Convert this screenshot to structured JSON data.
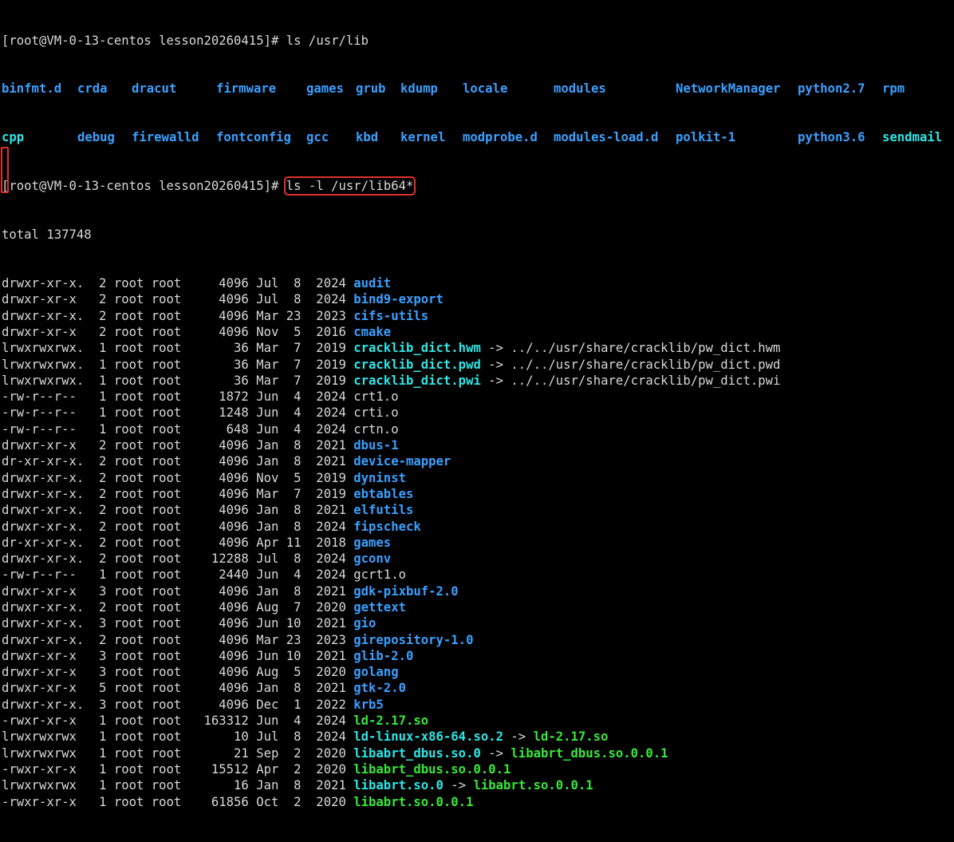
{
  "terminal": {
    "colors": {
      "background": "#000000",
      "text": "#d8d8d8",
      "directory": "#3ba0ff",
      "symlink": "#2ee6e6",
      "executable": "#38e838",
      "highlight": "#e0322b"
    },
    "line1": {
      "prompt": "[root@VM-0-13-centos lesson20260415]# ",
      "command": "ls /usr/lib"
    },
    "lib_row1": [
      {
        "name": "binfmt.d",
        "kind": "dir"
      },
      {
        "name": "crda",
        "kind": "dir"
      },
      {
        "name": "dracut",
        "kind": "dir"
      },
      {
        "name": "firmware",
        "kind": "dir"
      },
      {
        "name": "games",
        "kind": "dir"
      },
      {
        "name": "grub",
        "kind": "dir"
      },
      {
        "name": "kdump",
        "kind": "dir"
      },
      {
        "name": "locale",
        "kind": "dir"
      },
      {
        "name": "modules",
        "kind": "dir"
      },
      {
        "name": "NetworkManager",
        "kind": "dir"
      },
      {
        "name": "python2.7",
        "kind": "dir"
      },
      {
        "name": "rpm",
        "kind": "dir"
      }
    ],
    "lib_row2": [
      {
        "name": "cpp",
        "kind": "link"
      },
      {
        "name": "debug",
        "kind": "dir"
      },
      {
        "name": "firewalld",
        "kind": "dir"
      },
      {
        "name": "fontconfig",
        "kind": "dir"
      },
      {
        "name": "gcc",
        "kind": "dir"
      },
      {
        "name": "kbd",
        "kind": "dir"
      },
      {
        "name": "kernel",
        "kind": "dir"
      },
      {
        "name": "modprobe.d",
        "kind": "dir"
      },
      {
        "name": "modules-load.d",
        "kind": "dir"
      },
      {
        "name": "polkit-1",
        "kind": "dir"
      },
      {
        "name": "python3.6",
        "kind": "dir"
      },
      {
        "name": "sendmail",
        "kind": "link"
      }
    ],
    "line4": {
      "prompt": "[root@VM-0-13-centos lesson20260415]# ",
      "command": "ls -l /usr/lib64*"
    },
    "total": "total 137748",
    "entries": [
      {
        "perm": "drwxr-xr-x.",
        "links": "2",
        "owner": "root",
        "group": "root",
        "size": "4096",
        "month": "Jul",
        "day": "8",
        "year": "2024",
        "name": "audit",
        "kind": "dir",
        "target": "",
        "target_kind": ""
      },
      {
        "perm": "drwxr-xr-x",
        "links": "2",
        "owner": "root",
        "group": "root",
        "size": "4096",
        "month": "Jul",
        "day": "8",
        "year": "2024",
        "name": "bind9-export",
        "kind": "dir",
        "target": "",
        "target_kind": ""
      },
      {
        "perm": "drwxr-xr-x.",
        "links": "2",
        "owner": "root",
        "group": "root",
        "size": "4096",
        "month": "Mar",
        "day": "23",
        "year": "2023",
        "name": "cifs-utils",
        "kind": "dir",
        "target": "",
        "target_kind": ""
      },
      {
        "perm": "drwxr-xr-x",
        "links": "2",
        "owner": "root",
        "group": "root",
        "size": "4096",
        "month": "Nov",
        "day": "5",
        "year": "2016",
        "name": "cmake",
        "kind": "dir",
        "target": "",
        "target_kind": ""
      },
      {
        "perm": "lrwxrwxrwx.",
        "links": "1",
        "owner": "root",
        "group": "root",
        "size": "36",
        "month": "Mar",
        "day": "7",
        "year": "2019",
        "name": "cracklib_dict.hwm",
        "kind": "link",
        "target": "../../usr/share/cracklib/pw_dict.hwm",
        "target_kind": "plain"
      },
      {
        "perm": "lrwxrwxrwx.",
        "links": "1",
        "owner": "root",
        "group": "root",
        "size": "36",
        "month": "Mar",
        "day": "7",
        "year": "2019",
        "name": "cracklib_dict.pwd",
        "kind": "link",
        "target": "../../usr/share/cracklib/pw_dict.pwd",
        "target_kind": "plain"
      },
      {
        "perm": "lrwxrwxrwx.",
        "links": "1",
        "owner": "root",
        "group": "root",
        "size": "36",
        "month": "Mar",
        "day": "7",
        "year": "2019",
        "name": "cracklib_dict.pwi",
        "kind": "link",
        "target": "../../usr/share/cracklib/pw_dict.pwi",
        "target_kind": "plain"
      },
      {
        "perm": "-rw-r--r--",
        "links": "1",
        "owner": "root",
        "group": "root",
        "size": "1872",
        "month": "Jun",
        "day": "4",
        "year": "2024",
        "name": "crt1.o",
        "kind": "file",
        "target": "",
        "target_kind": ""
      },
      {
        "perm": "-rw-r--r--",
        "links": "1",
        "owner": "root",
        "group": "root",
        "size": "1248",
        "month": "Jun",
        "day": "4",
        "year": "2024",
        "name": "crti.o",
        "kind": "file",
        "target": "",
        "target_kind": ""
      },
      {
        "perm": "-rw-r--r--",
        "links": "1",
        "owner": "root",
        "group": "root",
        "size": "648",
        "month": "Jun",
        "day": "4",
        "year": "2024",
        "name": "crtn.o",
        "kind": "file",
        "target": "",
        "target_kind": ""
      },
      {
        "perm": "drwxr-xr-x",
        "links": "2",
        "owner": "root",
        "group": "root",
        "size": "4096",
        "month": "Jan",
        "day": "8",
        "year": "2021",
        "name": "dbus-1",
        "kind": "dir",
        "target": "",
        "target_kind": ""
      },
      {
        "perm": "dr-xr-xr-x.",
        "links": "2",
        "owner": "root",
        "group": "root",
        "size": "4096",
        "month": "Jan",
        "day": "8",
        "year": "2021",
        "name": "device-mapper",
        "kind": "dir",
        "target": "",
        "target_kind": ""
      },
      {
        "perm": "drwxr-xr-x.",
        "links": "2",
        "owner": "root",
        "group": "root",
        "size": "4096",
        "month": "Nov",
        "day": "5",
        "year": "2019",
        "name": "dyninst",
        "kind": "dir",
        "target": "",
        "target_kind": ""
      },
      {
        "perm": "drwxr-xr-x.",
        "links": "2",
        "owner": "root",
        "group": "root",
        "size": "4096",
        "month": "Mar",
        "day": "7",
        "year": "2019",
        "name": "ebtables",
        "kind": "dir",
        "target": "",
        "target_kind": ""
      },
      {
        "perm": "drwxr-xr-x.",
        "links": "2",
        "owner": "root",
        "group": "root",
        "size": "4096",
        "month": "Jan",
        "day": "8",
        "year": "2021",
        "name": "elfutils",
        "kind": "dir",
        "target": "",
        "target_kind": ""
      },
      {
        "perm": "drwxr-xr-x.",
        "links": "2",
        "owner": "root",
        "group": "root",
        "size": "4096",
        "month": "Jan",
        "day": "8",
        "year": "2024",
        "name": "fipscheck",
        "kind": "dir",
        "target": "",
        "target_kind": ""
      },
      {
        "perm": "dr-xr-xr-x.",
        "links": "2",
        "owner": "root",
        "group": "root",
        "size": "4096",
        "month": "Apr",
        "day": "11",
        "year": "2018",
        "name": "games",
        "kind": "dir",
        "target": "",
        "target_kind": ""
      },
      {
        "perm": "drwxr-xr-x.",
        "links": "2",
        "owner": "root",
        "group": "root",
        "size": "12288",
        "month": "Jul",
        "day": "8",
        "year": "2024",
        "name": "gconv",
        "kind": "dir",
        "target": "",
        "target_kind": ""
      },
      {
        "perm": "-rw-r--r--",
        "links": "1",
        "owner": "root",
        "group": "root",
        "size": "2440",
        "month": "Jun",
        "day": "4",
        "year": "2024",
        "name": "gcrt1.o",
        "kind": "file",
        "target": "",
        "target_kind": ""
      },
      {
        "perm": "drwxr-xr-x",
        "links": "3",
        "owner": "root",
        "group": "root",
        "size": "4096",
        "month": "Jan",
        "day": "8",
        "year": "2021",
        "name": "gdk-pixbuf-2.0",
        "kind": "dir",
        "target": "",
        "target_kind": ""
      },
      {
        "perm": "drwxr-xr-x.",
        "links": "2",
        "owner": "root",
        "group": "root",
        "size": "4096",
        "month": "Aug",
        "day": "7",
        "year": "2020",
        "name": "gettext",
        "kind": "dir",
        "target": "",
        "target_kind": ""
      },
      {
        "perm": "drwxr-xr-x.",
        "links": "3",
        "owner": "root",
        "group": "root",
        "size": "4096",
        "month": "Jun",
        "day": "10",
        "year": "2021",
        "name": "gio",
        "kind": "dir",
        "target": "",
        "target_kind": ""
      },
      {
        "perm": "drwxr-xr-x.",
        "links": "2",
        "owner": "root",
        "group": "root",
        "size": "4096",
        "month": "Mar",
        "day": "23",
        "year": "2023",
        "name": "girepository-1.0",
        "kind": "dir",
        "target": "",
        "target_kind": ""
      },
      {
        "perm": "drwxr-xr-x",
        "links": "3",
        "owner": "root",
        "group": "root",
        "size": "4096",
        "month": "Jun",
        "day": "10",
        "year": "2021",
        "name": "glib-2.0",
        "kind": "dir",
        "target": "",
        "target_kind": ""
      },
      {
        "perm": "drwxr-xr-x",
        "links": "3",
        "owner": "root",
        "group": "root",
        "size": "4096",
        "month": "Aug",
        "day": "5",
        "year": "2020",
        "name": "golang",
        "kind": "dir",
        "target": "",
        "target_kind": ""
      },
      {
        "perm": "drwxr-xr-x",
        "links": "5",
        "owner": "root",
        "group": "root",
        "size": "4096",
        "month": "Jan",
        "day": "8",
        "year": "2021",
        "name": "gtk-2.0",
        "kind": "dir",
        "target": "",
        "target_kind": ""
      },
      {
        "perm": "drwxr-xr-x.",
        "links": "3",
        "owner": "root",
        "group": "root",
        "size": "4096",
        "month": "Dec",
        "day": "1",
        "year": "2022",
        "name": "krb5",
        "kind": "dir",
        "target": "",
        "target_kind": ""
      },
      {
        "perm": "-rwxr-xr-x",
        "links": "1",
        "owner": "root",
        "group": "root",
        "size": "163312",
        "month": "Jun",
        "day": "4",
        "year": "2024",
        "name": "ld-2.17.so",
        "kind": "exec",
        "target": "",
        "target_kind": ""
      },
      {
        "perm": "lrwxrwxrwx",
        "links": "1",
        "owner": "root",
        "group": "root",
        "size": "10",
        "month": "Jul",
        "day": "8",
        "year": "2024",
        "name": "ld-linux-x86-64.so.2",
        "kind": "link",
        "target": "ld-2.17.so",
        "target_kind": "exec"
      },
      {
        "perm": "lrwxrwxrwx",
        "links": "1",
        "owner": "root",
        "group": "root",
        "size": "21",
        "month": "Sep",
        "day": "2",
        "year": "2020",
        "name": "libabrt_dbus.so.0",
        "kind": "link",
        "target": "libabrt_dbus.so.0.0.1",
        "target_kind": "exec"
      },
      {
        "perm": "-rwxr-xr-x",
        "links": "1",
        "owner": "root",
        "group": "root",
        "size": "15512",
        "month": "Apr",
        "day": "2",
        "year": "2020",
        "name": "libabrt_dbus.so.0.0.1",
        "kind": "exec",
        "target": "",
        "target_kind": ""
      },
      {
        "perm": "lrwxrwxrwx",
        "links": "1",
        "owner": "root",
        "group": "root",
        "size": "16",
        "month": "Jan",
        "day": "8",
        "year": "2021",
        "name": "libabrt.so.0",
        "kind": "link",
        "target": "libabrt.so.0.0.1",
        "target_kind": "exec"
      },
      {
        "perm": "-rwxr-xr-x",
        "links": "1",
        "owner": "root",
        "group": "root",
        "size": "61856",
        "month": "Oct",
        "day": "2",
        "year": "2020",
        "name": "libabrt.so.0.0.1",
        "kind": "exec",
        "target": "",
        "target_kind": ""
      }
    ],
    "arrow": " -> "
  }
}
